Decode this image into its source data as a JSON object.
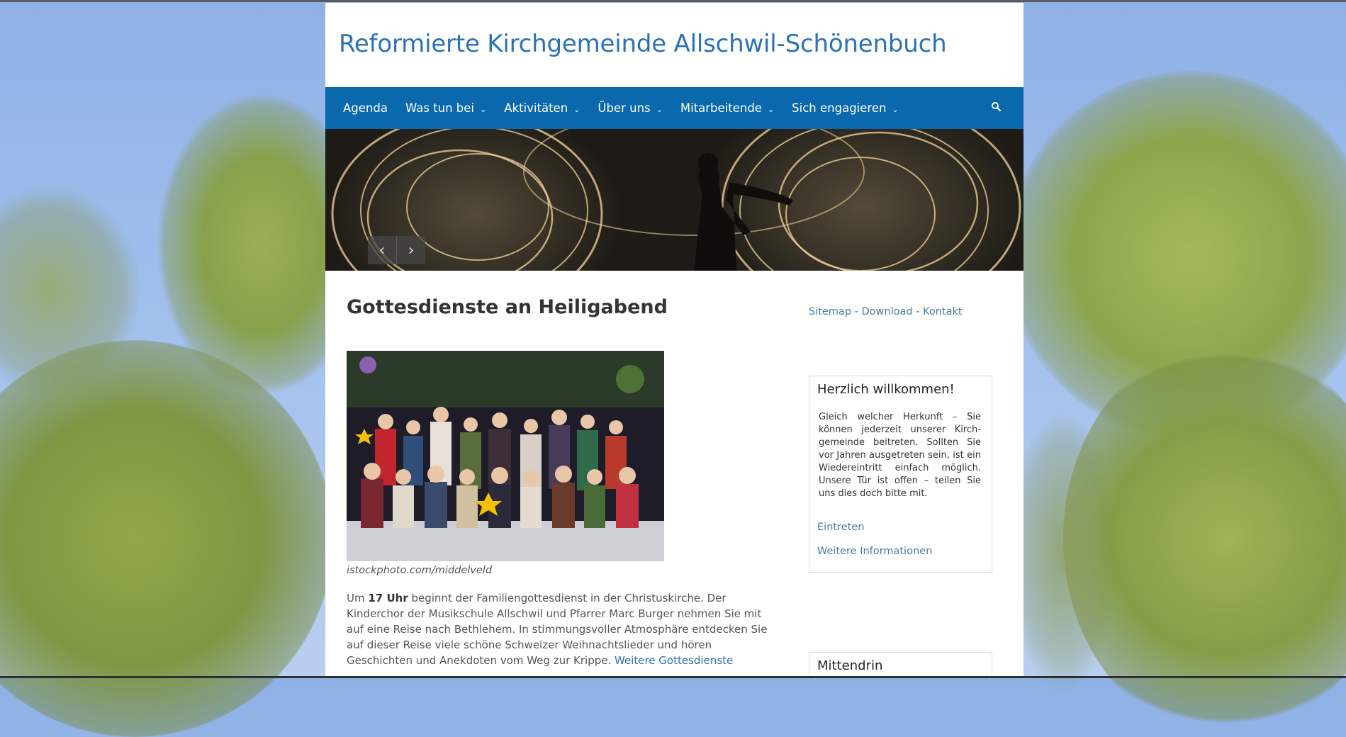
{
  "site": {
    "title": "Reformierte Kirchgemeinde Allschwil-Schönenbuch"
  },
  "nav": {
    "items": [
      {
        "label": "Agenda",
        "has_dropdown": false
      },
      {
        "label": "Was tun bei",
        "has_dropdown": true
      },
      {
        "label": "Aktivitäten",
        "has_dropdown": true
      },
      {
        "label": "Über uns",
        "has_dropdown": true
      },
      {
        "label": "Mitarbeitende",
        "has_dropdown": true
      },
      {
        "label": "Sich engagieren",
        "has_dropdown": true
      }
    ],
    "caret": "⌄",
    "search_icon": "search-icon"
  },
  "slider": {
    "prev": "‹",
    "next": "›"
  },
  "post": {
    "title": "Gottesdienste an Heiligabend",
    "caption": "istockphoto.com/middelveld",
    "text_before": "Um ",
    "text_bold": "17 Uhr",
    "text_after": " beginnt der Familiengottesdienst in der Christuskirche. Der Kinderchor der Musikschule Allschwil und Pfarrer Marc Burger nehmen Sie mit auf eine Reise nach Bethlehem. In stimmungsvoller Atmosphäre entdecken Sie auf dieser Reise viele schöne Schweizer Weihnachtslieder und hören Geschichten und Anekdoten vom Weg zur Krippe. ",
    "link": "Weitere Gottesdienste"
  },
  "sidebar": {
    "links": [
      "Sitemap",
      "Download",
      "Kontakt"
    ],
    "separator": " - ",
    "welcome": {
      "title": "Herzlich willkommen!",
      "text": "Gleich welcher Herkunft – Sie können jederzeit unserer Kirch­gemeinde beitreten. Sollten Sie vor Jahren ausgetreten sein, ist ein Wiedereintritt einfach möglich. Unsere Tür ist offen – teilen Sie uns dies doch bitte mit.",
      "link1": "Eintreten",
      "link2": "Weitere Informationen"
    },
    "second_widget": {
      "title": "Mittendrin"
    }
  },
  "colors": {
    "nav_bg": "#0a68ad",
    "title_blue": "#2a72b5",
    "link_blue": "#4a78a8"
  }
}
